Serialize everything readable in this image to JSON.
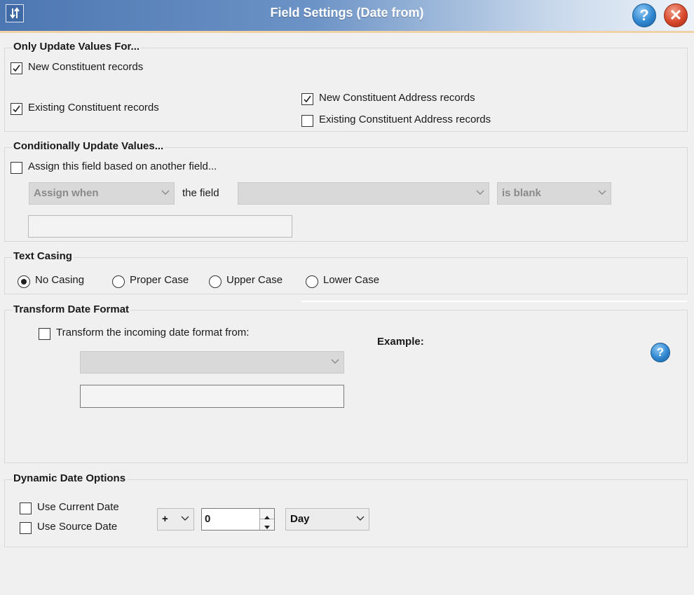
{
  "window": {
    "title": "Field Settings (Date from)",
    "help_glyph": "?",
    "close_glyph": "✕"
  },
  "only_update": {
    "title": "Only Update Values For...",
    "new_constituent": {
      "label": "New Constituent records",
      "checked": true
    },
    "existing_constituent": {
      "label": "Existing Constituent records",
      "checked": true
    },
    "new_address": {
      "label": "New Constituent Address records",
      "checked": true
    },
    "existing_address": {
      "label": "Existing Constituent Address records",
      "checked": false
    }
  },
  "conditional": {
    "title": "Conditionally Update Values...",
    "assign_label": "Assign this field based on another field...",
    "assign_checked": false,
    "assign_when": "Assign when",
    "the_field_label": "the field",
    "field_value": "",
    "operator": "is blank",
    "value": ""
  },
  "text_casing": {
    "title": "Text Casing",
    "options": [
      "No Casing",
      "Proper Case",
      "Upper Case",
      "Lower Case"
    ],
    "selected": "No Casing"
  },
  "transform_date": {
    "title": "Transform Date Format",
    "checkbox_label": "Transform the incoming date format from:",
    "checked": false,
    "format_value": "",
    "input_value": "",
    "example_label": "Example:"
  },
  "dynamic_date": {
    "title": "Dynamic Date Options",
    "use_current": {
      "label": "Use Current Date",
      "checked": false
    },
    "use_source": {
      "label": "Use Source Date",
      "checked": false
    },
    "sign": "+",
    "amount": "0",
    "unit": "Day"
  },
  "icons": {
    "app": "settings-sliders-icon",
    "help": "help-icon",
    "close": "close-icon",
    "example_help": "help-icon"
  }
}
